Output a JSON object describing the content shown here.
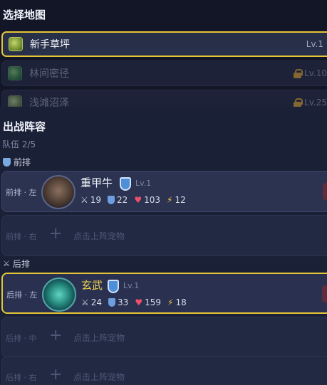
{
  "map": {
    "title": "选择地图",
    "items": [
      {
        "name": "新手草坪",
        "level": "Lv.1",
        "locked": false,
        "selected": true
      },
      {
        "name": "林间密径",
        "level": "Lv.10",
        "locked": true,
        "selected": false
      },
      {
        "name": "浅滩沼泽",
        "level": "Lv.25",
        "locked": true,
        "selected": false
      }
    ]
  },
  "lineup": {
    "title": "出战阵容",
    "team_count": "队伍 2/5",
    "front_label": "前排",
    "back_label": "后排",
    "empty_text": "点击上阵宠物",
    "slots": [
      {
        "pos": "前排 · 左",
        "name": "重甲牛",
        "level": "Lv.1",
        "atk": "19",
        "def": "22",
        "hp": "103",
        "spd": "12"
      },
      {
        "pos": "前排 · 右"
      },
      {
        "pos": "后排 · 左",
        "name": "玄武",
        "level": "Lv.1",
        "atk": "24",
        "def": "33",
        "hp": "159",
        "spd": "18"
      },
      {
        "pos": "后排 · 中"
      },
      {
        "pos": "后排 · 右"
      }
    ]
  }
}
